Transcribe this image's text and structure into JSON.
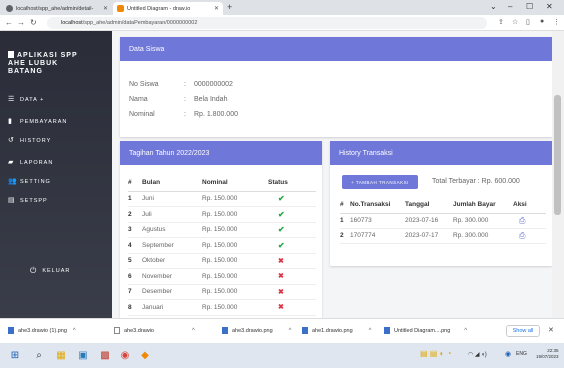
{
  "browser": {
    "tabs": [
      {
        "title": "localhost/spp_ahe/admin/detail-",
        "active": false
      },
      {
        "title": "Untitled Diagram - draw.io",
        "active": true
      }
    ],
    "url_host": "localhost",
    "url_path": "/spp_ahe/admin/dataPembayaran/0000000002"
  },
  "sidebar": {
    "brand_line1": "APLIKASI SPP",
    "brand_line2": "AHE LUBUK",
    "brand_line3": "BATANG",
    "items": [
      {
        "label": "DATA +",
        "icon": "list-icon"
      },
      {
        "label": "PEMBAYARAN",
        "icon": "wallet-icon"
      },
      {
        "label": "HISTORY",
        "icon": "history-icon"
      },
      {
        "label": "LAPORAN",
        "icon": "report-icon"
      },
      {
        "label": "SETTING",
        "icon": "users-icon"
      },
      {
        "label": "SETSPP",
        "icon": "setspp-icon"
      }
    ],
    "logout_label": "KELUAR"
  },
  "siswa": {
    "header": "Data Siswa",
    "no_label": "No Siswa",
    "no_value": "0000000002",
    "nama_label": "Nama",
    "nama_value": "Bela Indah",
    "nominal_label": "Nominal",
    "nominal_value": "Rp. 1.800.000",
    "sep": ":"
  },
  "tagihan": {
    "header": "Tagihan Tahun 2022/2023",
    "columns": [
      "#",
      "Bulan",
      "Nominal",
      "Status"
    ],
    "rows": [
      {
        "no": "1",
        "bulan": "Juni",
        "nominal": "Rp. 150.000",
        "status": "paid"
      },
      {
        "no": "2",
        "bulan": "Juli",
        "nominal": "Rp. 150.000",
        "status": "paid"
      },
      {
        "no": "3",
        "bulan": "Agustus",
        "nominal": "Rp. 150.000",
        "status": "paid"
      },
      {
        "no": "4",
        "bulan": "September",
        "nominal": "Rp. 150.000",
        "status": "paid"
      },
      {
        "no": "5",
        "bulan": "Oktober",
        "nominal": "Rp. 150.000",
        "status": "unpaid"
      },
      {
        "no": "6",
        "bulan": "November",
        "nominal": "Rp. 150.000",
        "status": "unpaid"
      },
      {
        "no": "7",
        "bulan": "Desember",
        "nominal": "Rp. 150.000",
        "status": "unpaid"
      },
      {
        "no": "8",
        "bulan": "Januari",
        "nominal": "Rp. 150.000",
        "status": "unpaid"
      }
    ],
    "paid_glyph": "✔",
    "unpaid_glyph": "✖"
  },
  "history": {
    "header": "History Transaksi",
    "add_button": "+ TAMBAH TRANSAKSI",
    "total": "Total Terbayar : Rp. 600.000",
    "columns": [
      "#",
      "No.Transaksi",
      "Tanggal",
      "Jumlah Bayar",
      "Aksi"
    ],
    "rows": [
      {
        "no": "1",
        "no_transaksi": "160773",
        "tanggal": "2023-07-16",
        "jumlah": "Rp. 300.000"
      },
      {
        "no": "2",
        "no_transaksi": "1707774",
        "tanggal": "2023-07-17",
        "jumlah": "Rp. 300.000"
      }
    ]
  },
  "downloads": {
    "items": [
      "ahe3.drawio (1).png",
      "ahe3.drawio",
      "ahe3.drawio.png",
      "ahe1.drawio.png",
      "Untitled Diagram....png"
    ],
    "show_all": "Show all"
  },
  "taskbar": {
    "lang": "ENG",
    "time": "22:35",
    "date": "19/07/2023"
  },
  "colors": {
    "accent": "#6f77d8",
    "paid": "#28a745",
    "unpaid": "#dc3545"
  }
}
